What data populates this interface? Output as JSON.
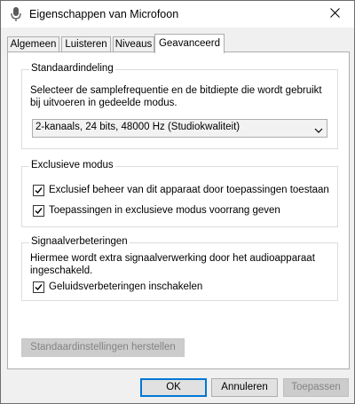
{
  "window": {
    "title": "Eigenschappen van Microfoon"
  },
  "tabs": [
    {
      "label": "Algemeen"
    },
    {
      "label": "Luisteren"
    },
    {
      "label": "Niveaus"
    },
    {
      "label": "Geavanceerd"
    }
  ],
  "default_format": {
    "title": "Standaardindeling",
    "description": "Selecteer de samplefrequentie en de bitdiepte die wordt gebruikt bij uitvoeren in gedeelde modus.",
    "selected": "2-kanaals, 24 bits, 48000 Hz (Studiokwaliteit)"
  },
  "exclusive_mode": {
    "title": "Exclusieve modus",
    "options": [
      {
        "label": "Exclusief beheer van dit apparaat door toepassingen toestaan",
        "checked": true
      },
      {
        "label": "Toepassingen in exclusieve modus voorrang geven",
        "checked": true
      }
    ]
  },
  "enhancements": {
    "title": "Signaalverbeteringen",
    "description": "Hiermee wordt extra signaalverwerking door het audioapparaat ingeschakeld.",
    "option": {
      "label": "Geluidsverbeteringen inschakelen",
      "checked": true
    }
  },
  "buttons": {
    "restore_defaults": "Standaardinstellingen herstellen",
    "ok": "OK",
    "cancel": "Annuleren",
    "apply": "Toepassen"
  }
}
